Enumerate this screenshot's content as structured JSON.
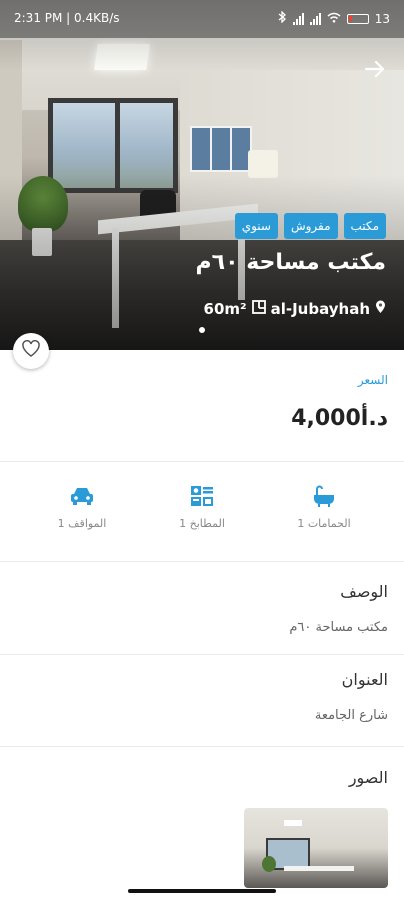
{
  "status_bar": {
    "time_speed": "2:31 PM | 0.4KB/s",
    "battery": "13"
  },
  "listing": {
    "tags": [
      "سنوي",
      "مفروش",
      "مكتب"
    ],
    "title": "مكتب مساحة ٦٠م",
    "area": "60m²",
    "location": "al-Jubayhah"
  },
  "price": {
    "label": "السعر",
    "value": "4,000",
    "currency": "د.أ"
  },
  "features": [
    {
      "icon": "bath-icon",
      "label": "الحمامات 1"
    },
    {
      "icon": "kitchen-icon",
      "label": "المطابخ 1"
    },
    {
      "icon": "car-icon",
      "label": "المواقف 1"
    }
  ],
  "description": {
    "title": "الوصف",
    "text": "مكتب مساحة ٦٠م"
  },
  "address": {
    "title": "العنوان",
    "text": "شارع الجامعة"
  },
  "photos": {
    "title": "الصور"
  },
  "colors": {
    "accent": "#2a9bd6"
  }
}
